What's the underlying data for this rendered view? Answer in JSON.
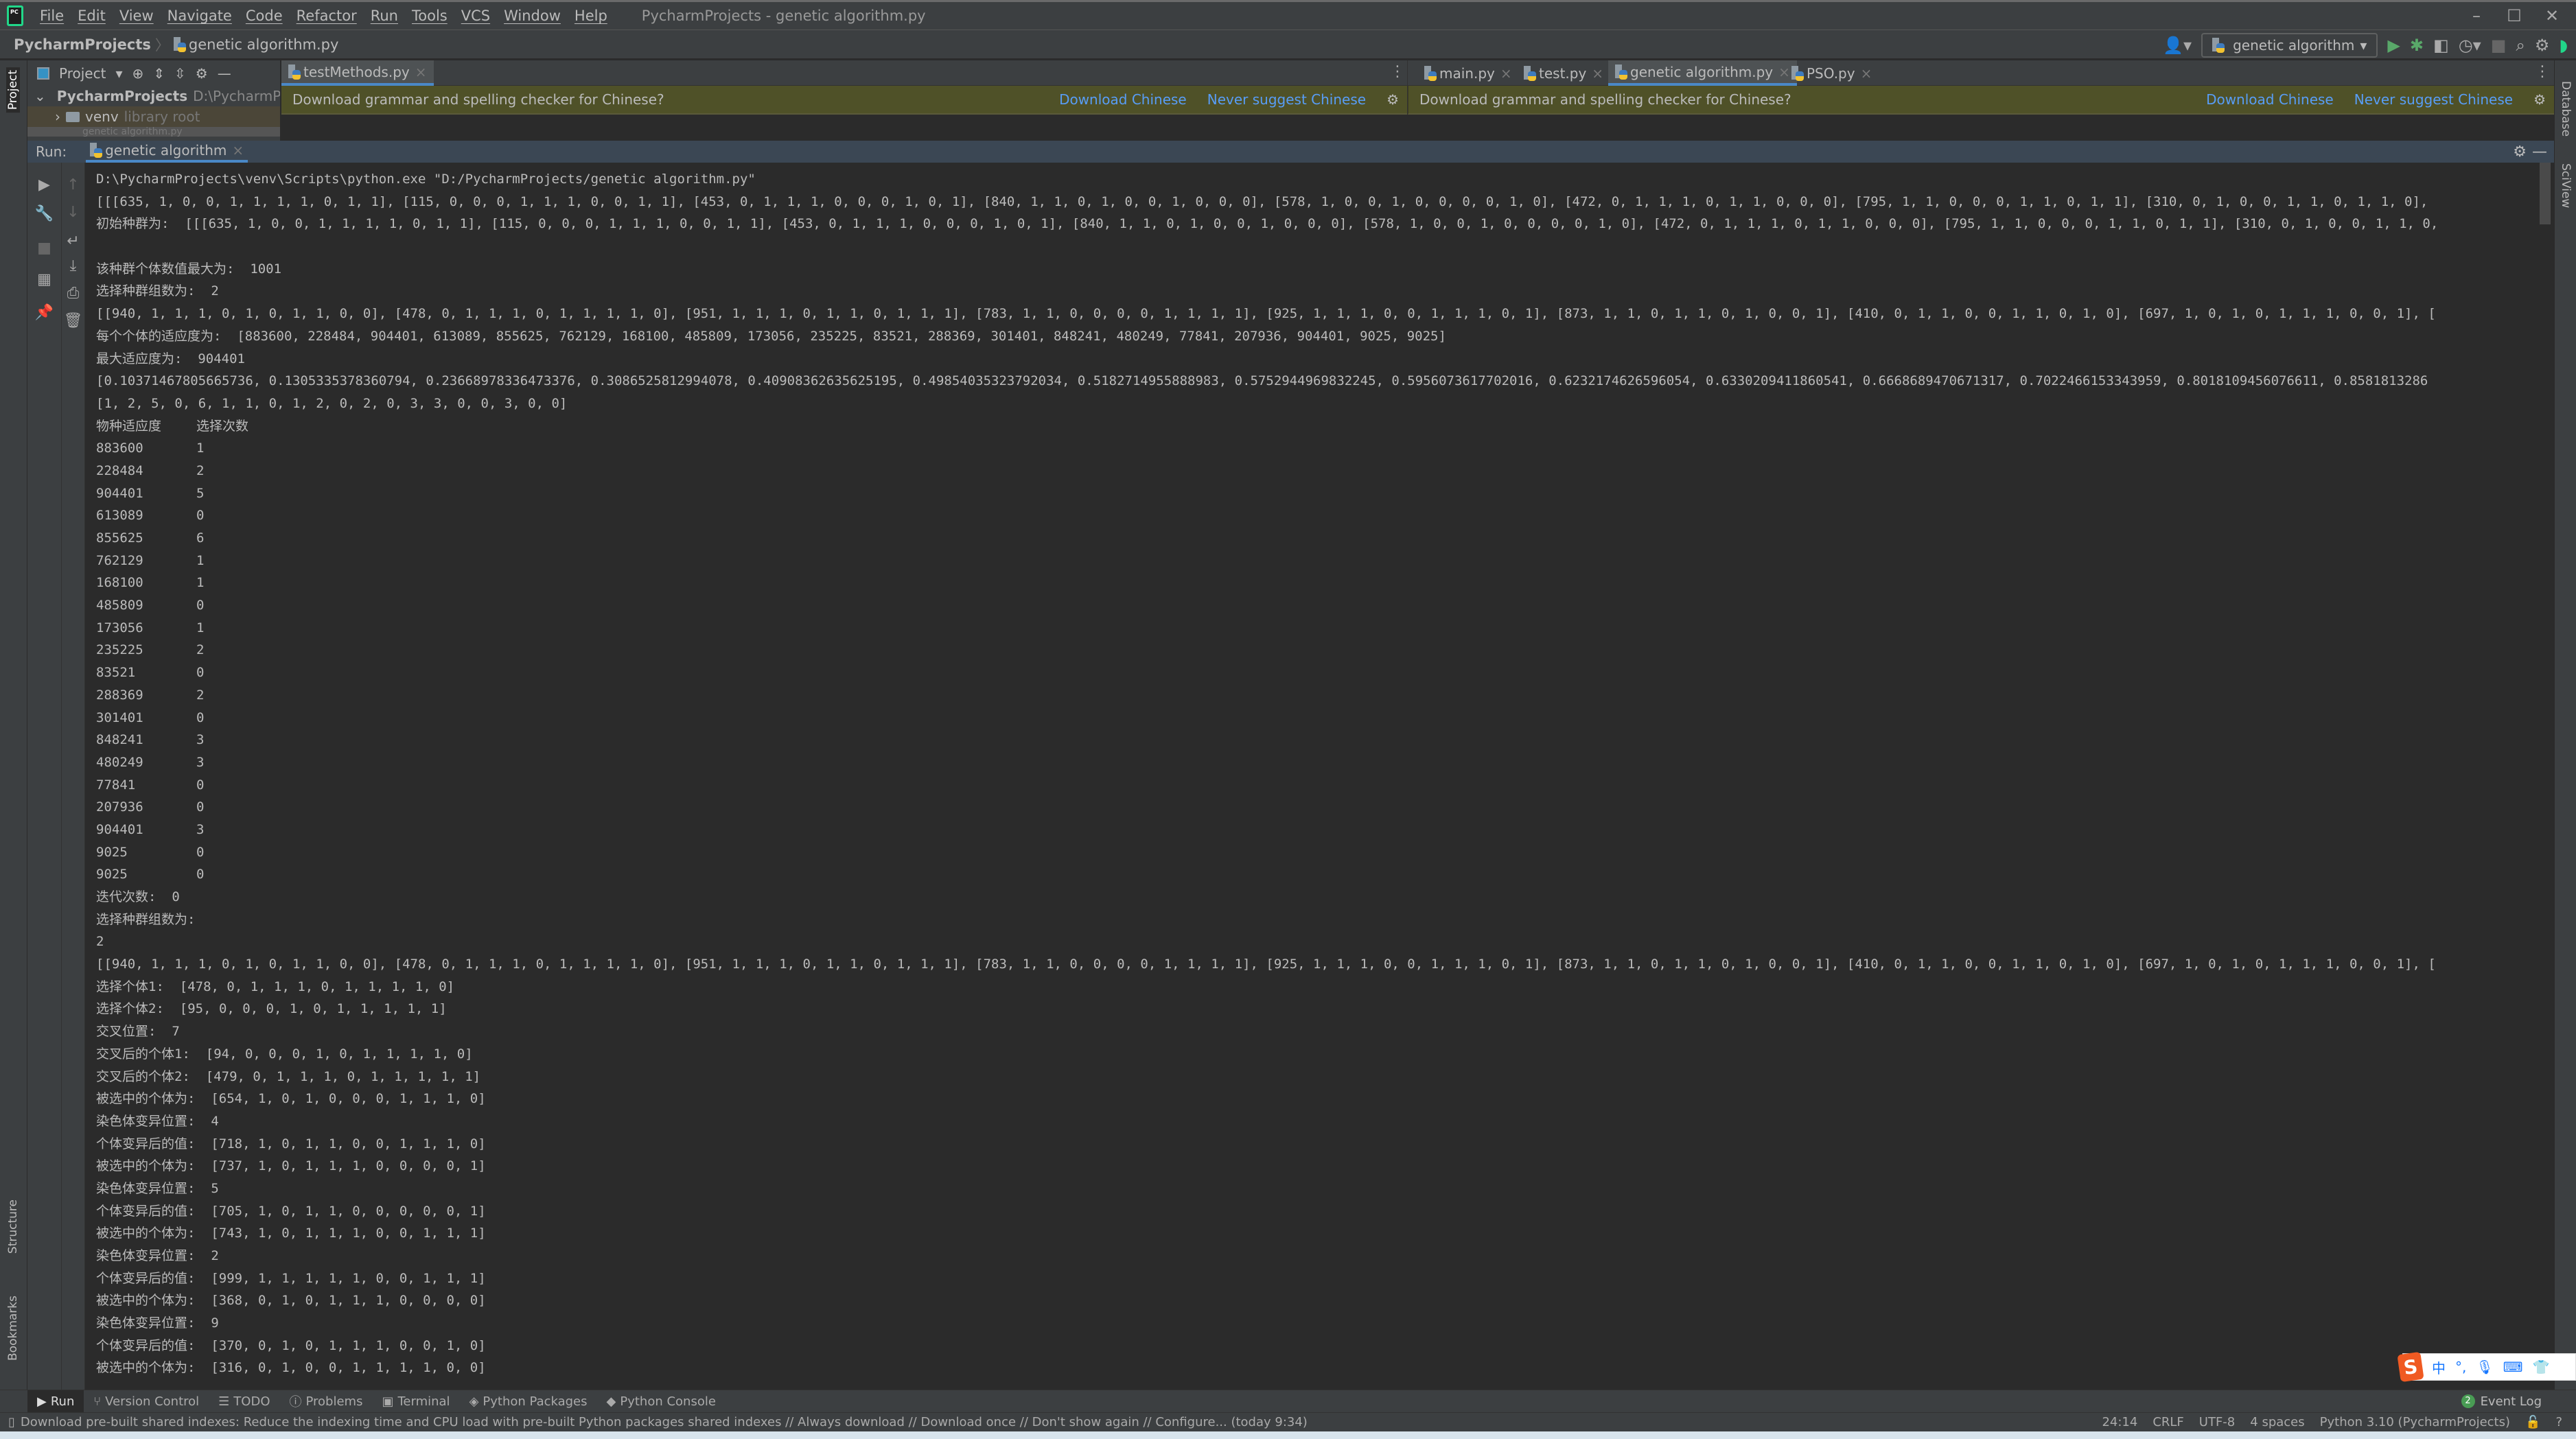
{
  "titlebar": {
    "menu": [
      "File",
      "Edit",
      "View",
      "Navigate",
      "Code",
      "Refactor",
      "Run",
      "Tools",
      "VCS",
      "Window",
      "Help"
    ],
    "window_title": "PycharmProjects - genetic algorithm.py",
    "controls": {
      "minimize": "–",
      "maximize": "☐",
      "close": "✕"
    }
  },
  "navbar": {
    "breadcrumb_root": "PycharmProjects",
    "breadcrumb_file": "genetic algorithm.py",
    "run_config": "genetic algorithm",
    "icons": [
      "user-icon",
      "run-icon",
      "debug-icon",
      "coverage-icon",
      "profile-icon",
      "stop-icon",
      "search-icon",
      "settings-icon",
      "toolbox-icon"
    ]
  },
  "left_stripe": {
    "project": "Project",
    "structure": "Structure",
    "bookmarks": "Bookmarks"
  },
  "right_stripe": {
    "database": "Database",
    "sciview": "SciView"
  },
  "project_panel": {
    "title": "Project",
    "root_name": "PycharmProjects",
    "root_path": "D:\\PycharmProje",
    "venv": "venv",
    "venv_hint": "library root",
    "partial_item": "genetic algorithm.py"
  },
  "tabs": [
    {
      "label": "testMethods.py",
      "active": true
    },
    {
      "label": "main.py",
      "active": false
    },
    {
      "label": "test.py",
      "active": false
    },
    {
      "label": "genetic algorithm.py",
      "active": true
    },
    {
      "label": "PSO.py",
      "active": false
    }
  ],
  "notification": {
    "message": "Download grammar and spelling checker for Chinese?",
    "download": "Download Chinese",
    "never": "Never suggest Chinese"
  },
  "run": {
    "label": "Run:",
    "tab": "genetic algorithm"
  },
  "console": {
    "lines_top": [
      "D:\\PycharmProjects\\venv\\Scripts\\python.exe \"D:/PycharmProjects/genetic algorithm.py\"",
      "[[[635, 1, 0, 0, 1, 1, 1, 1, 0, 1, 1], [115, 0, 0, 0, 1, 1, 1, 0, 0, 1, 1], [453, 0, 1, 1, 1, 0, 0, 0, 1, 0, 1], [840, 1, 1, 0, 1, 0, 0, 1, 0, 0, 0], [578, 1, 0, 0, 1, 0, 0, 0, 0, 1, 0], [472, 0, 1, 1, 1, 0, 1, 1, 0, 0, 0], [795, 1, 1, 0, 0, 0, 1, 1, 0, 1, 1], [310, 0, 1, 0, 0, 1, 1, 0, 1, 1, 0],",
      "初始种群为:  [[[635, 1, 0, 0, 1, 1, 1, 1, 0, 1, 1], [115, 0, 0, 0, 1, 1, 1, 0, 0, 1, 1], [453, 0, 1, 1, 1, 0, 0, 0, 1, 0, 1], [840, 1, 1, 0, 1, 0, 0, 1, 0, 0, 0], [578, 1, 0, 0, 1, 0, 0, 0, 0, 1, 0], [472, 0, 1, 1, 1, 0, 1, 1, 0, 0, 0], [795, 1, 1, 0, 0, 0, 1, 1, 0, 1, 1], [310, 0, 1, 0, 0, 1, 1, 0,",
      "",
      "该种群个体数值最大为:  1001",
      "选择种群组数为:  2",
      "[[940, 1, 1, 1, 0, 1, 0, 1, 1, 0, 0], [478, 0, 1, 1, 1, 0, 1, 1, 1, 1, 0], [951, 1, 1, 1, 0, 1, 1, 0, 1, 1, 1], [783, 1, 1, 0, 0, 0, 0, 1, 1, 1, 1], [925, 1, 1, 1, 0, 0, 1, 1, 1, 0, 1], [873, 1, 1, 0, 1, 1, 0, 1, 0, 0, 1], [410, 0, 1, 1, 0, 0, 1, 1, 0, 1, 0], [697, 1, 0, 1, 0, 1, 1, 1, 0, 0, 1], [",
      "每个个体的适应度为:  [883600, 228484, 904401, 613089, 855625, 762129, 168100, 485809, 173056, 235225, 83521, 288369, 301401, 848241, 480249, 77841, 207936, 904401, 9025, 9025]",
      "最大适应度为:  904401",
      "[0.10371467805665736, 0.1305335378360794, 0.23668978336473376, 0.3086525812994078, 0.40908362635625195, 0.49854035323792034, 0.5182714955888983, 0.5752944969832245, 0.5956073617702016, 0.6232174626596054, 0.6330209411860541, 0.6668689470671317, 0.7022466153343959, 0.8018109456076611, 0.8581813286",
      "[1, 2, 5, 0, 6, 1, 1, 0, 1, 2, 0, 2, 0, 3, 3, 0, 0, 3, 0, 0]"
    ],
    "table": {
      "headers": [
        "物种适应度",
        "选择次数"
      ],
      "rows": [
        [
          "883600",
          "1"
        ],
        [
          "228484",
          "2"
        ],
        [
          "904401",
          "5"
        ],
        [
          "613089",
          "0"
        ],
        [
          "855625",
          "6"
        ],
        [
          "762129",
          "1"
        ],
        [
          "168100",
          "1"
        ],
        [
          "485809",
          "0"
        ],
        [
          "173056",
          "1"
        ],
        [
          "235225",
          "2"
        ],
        [
          "83521",
          "0"
        ],
        [
          "288369",
          "2"
        ],
        [
          "301401",
          "0"
        ],
        [
          "848241",
          "3"
        ],
        [
          "480249",
          "3"
        ],
        [
          "77841",
          "0"
        ],
        [
          "207936",
          "0"
        ],
        [
          "904401",
          "3"
        ],
        [
          "9025",
          "0"
        ],
        [
          "9025",
          "0"
        ]
      ]
    },
    "lines_bottom": [
      "迭代次数:  0",
      "选择种群组数为:",
      "2",
      "[[940, 1, 1, 1, 0, 1, 0, 1, 1, 0, 0], [478, 0, 1, 1, 1, 0, 1, 1, 1, 1, 0], [951, 1, 1, 1, 0, 1, 1, 0, 1, 1, 1], [783, 1, 1, 0, 0, 0, 0, 1, 1, 1, 1], [925, 1, 1, 1, 0, 0, 1, 1, 1, 0, 1], [873, 1, 1, 0, 1, 1, 0, 1, 0, 0, 1], [410, 0, 1, 1, 0, 0, 1, 1, 0, 1, 0], [697, 1, 0, 1, 0, 1, 1, 1, 0, 0, 1], [",
      "选择个体1:  [478, 0, 1, 1, 1, 0, 1, 1, 1, 1, 0]",
      "选择个体2:  [95, 0, 0, 0, 1, 0, 1, 1, 1, 1, 1]",
      "交叉位置:  7",
      "交叉后的个体1:  [94, 0, 0, 0, 1, 0, 1, 1, 1, 1, 0]",
      "交叉后的个体2:  [479, 0, 1, 1, 1, 0, 1, 1, 1, 1, 1]",
      "被选中的个体为:  [654, 1, 0, 1, 0, 0, 0, 1, 1, 1, 0]",
      "染色体变异位置:  4",
      "个体变异后的值:  [718, 1, 0, 1, 1, 0, 0, 1, 1, 1, 0]",
      "被选中的个体为:  [737, 1, 0, 1, 1, 1, 0, 0, 0, 0, 1]",
      "染色体变异位置:  5",
      "个体变异后的值:  [705, 1, 0, 1, 1, 0, 0, 0, 0, 0, 1]",
      "被选中的个体为:  [743, 1, 0, 1, 1, 1, 0, 0, 1, 1, 1]",
      "染色体变异位置:  2",
      "个体变异后的值:  [999, 1, 1, 1, 1, 1, 0, 0, 1, 1, 1]",
      "被选中的个体为:  [368, 0, 1, 0, 1, 1, 1, 0, 0, 0, 0]",
      "染色体变异位置:  9",
      "个体变异后的值:  [370, 0, 1, 0, 1, 1, 1, 0, 0, 1, 0]",
      "被选中的个体为:  [316, 0, 1, 0, 0, 1, 1, 1, 1, 0, 0]"
    ]
  },
  "toolwindows": [
    {
      "label": "Run",
      "icon": "run-icon",
      "glyph": "▶"
    },
    {
      "label": "Version Control",
      "icon": "vcs-icon",
      "glyph": "⑂"
    },
    {
      "label": "TODO",
      "icon": "todo-icon",
      "glyph": "☰"
    },
    {
      "label": "Problems",
      "icon": "problems-icon",
      "glyph": "ⓘ"
    },
    {
      "label": "Terminal",
      "icon": "terminal-icon",
      "glyph": "▣"
    },
    {
      "label": "Python Packages",
      "icon": "packages-icon",
      "glyph": "◈"
    },
    {
      "label": "Python Console",
      "icon": "python-console-icon",
      "glyph": "◆"
    }
  ],
  "event_log": {
    "count": "2",
    "label": "Event Log"
  },
  "statusbar": {
    "message": "Download pre-built shared indexes: Reduce the indexing time and CPU load with pre-built Python packages shared indexes // Always download // Download once // Don't show again // Configure... (today 9:34)",
    "position": "24:14",
    "line_sep": "CRLF",
    "encoding": "UTF-8",
    "indent": "4 spaces",
    "interpreter": "Python 3.10 (PycharmProjects)"
  },
  "ime": {
    "logo": "S",
    "mode": "中",
    "punct": "°,",
    "icons": [
      "mic-icon",
      "keyboard-icon",
      "skin-icon"
    ]
  }
}
